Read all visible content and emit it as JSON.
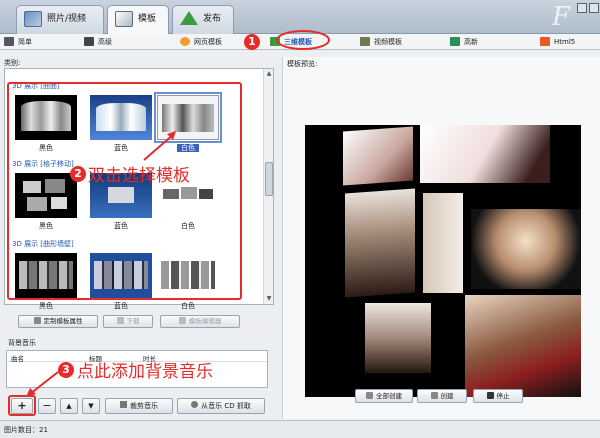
{
  "tabs": [
    {
      "label": "照片/视频"
    },
    {
      "label": "模板"
    },
    {
      "label": "发布"
    }
  ],
  "logo": {
    "text": "F"
  },
  "toolbar": {
    "items": [
      {
        "label": "简单",
        "icon": "list-icon"
      },
      {
        "label": "高级",
        "icon": "camera-icon"
      },
      {
        "label": "网页模板",
        "icon": "globe-icon"
      },
      {
        "label": "三维模板",
        "icon": "3d-template-icon"
      },
      {
        "label": "视频模板",
        "icon": "film-icon"
      },
      {
        "label": "高新",
        "icon": "picture-icon"
      },
      {
        "label": "Html5",
        "icon": "html5-icon"
      }
    ]
  },
  "left": {
    "category_label": "类别:",
    "sections": [
      {
        "title": "3D 展示 [曲面]",
        "items": [
          {
            "label": "黑色"
          },
          {
            "label": "蓝色"
          },
          {
            "label": "白色",
            "selected": true
          }
        ]
      },
      {
        "title": "3D 展示 [格子移动]",
        "items": [
          {
            "label": "黑色"
          },
          {
            "label": "蓝色"
          },
          {
            "label": "白色"
          }
        ]
      },
      {
        "title": "3D 展示 [曲形墙壁]",
        "items": [
          {
            "label": "黑色"
          },
          {
            "label": "蓝色"
          },
          {
            "label": "白色"
          }
        ]
      }
    ],
    "buttons": {
      "customize": "定制模板属性",
      "download": "下载",
      "editor": "模板编辑器"
    },
    "music": {
      "label": "背景音乐",
      "col_name": "曲名",
      "col_title": "标题",
      "col_duration": "时长"
    },
    "bottom": {
      "add": "+",
      "remove": "−",
      "up": "▲",
      "down": "▼",
      "trim": "裁剪音乐",
      "cd": "从音乐 CD 抓取"
    }
  },
  "right": {
    "preview_label": "模板预览:",
    "buttons": {
      "create_all": "全部创建",
      "create": "创建",
      "stop": "停止"
    }
  },
  "status": {
    "text": "图片数目：21"
  },
  "annotations": {
    "n1": "1",
    "n2": "2",
    "n3": "3",
    "text2": "双击选择模板",
    "text3": "点此添加背景音乐"
  },
  "colors": {
    "accent_red": "#e52b2b",
    "section_blue": "#1f58b0"
  }
}
